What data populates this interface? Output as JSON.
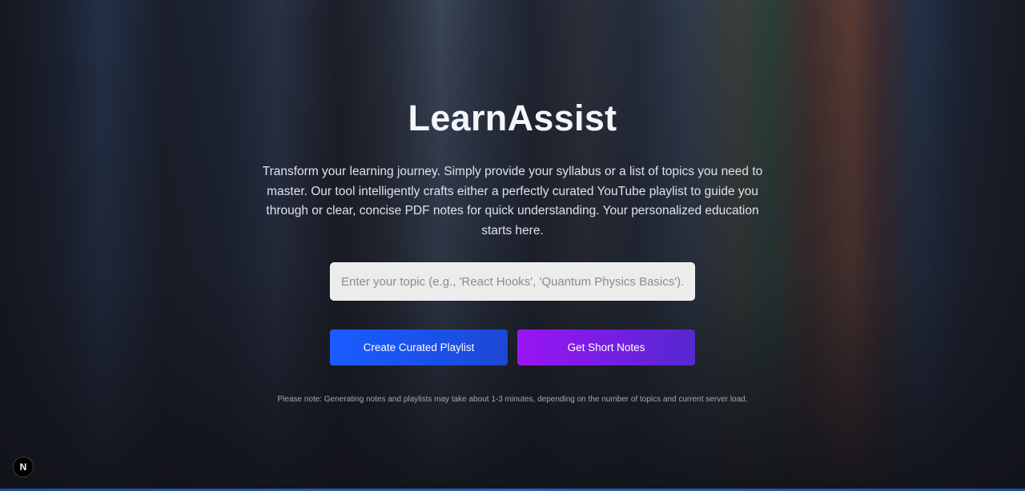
{
  "hero": {
    "title": "LearnAssist",
    "description": "Transform your learning journey. Simply provide your syllabus or a list of topics you need to master. Our tool intelligently crafts either a perfectly curated YouTube playlist to guide you through or clear, concise PDF notes for quick understanding. Your personalized education starts here."
  },
  "search": {
    "placeholder": "Enter your topic (e.g., 'React Hooks', 'Quantum Physics Basics')...",
    "value": ""
  },
  "actions": {
    "playlist_label": "Create Curated Playlist",
    "notes_label": "Get Short Notes"
  },
  "footer": {
    "note": "Please note: Generating notes and playlists may take about 1-3 minutes, depending on the number of topics and current server load."
  },
  "badge": {
    "letter": "N",
    "icon": "nextjs-icon"
  },
  "colors": {
    "playlist_button": "#1a5cff",
    "notes_button": "#9a14f5",
    "background": "#14161d"
  }
}
